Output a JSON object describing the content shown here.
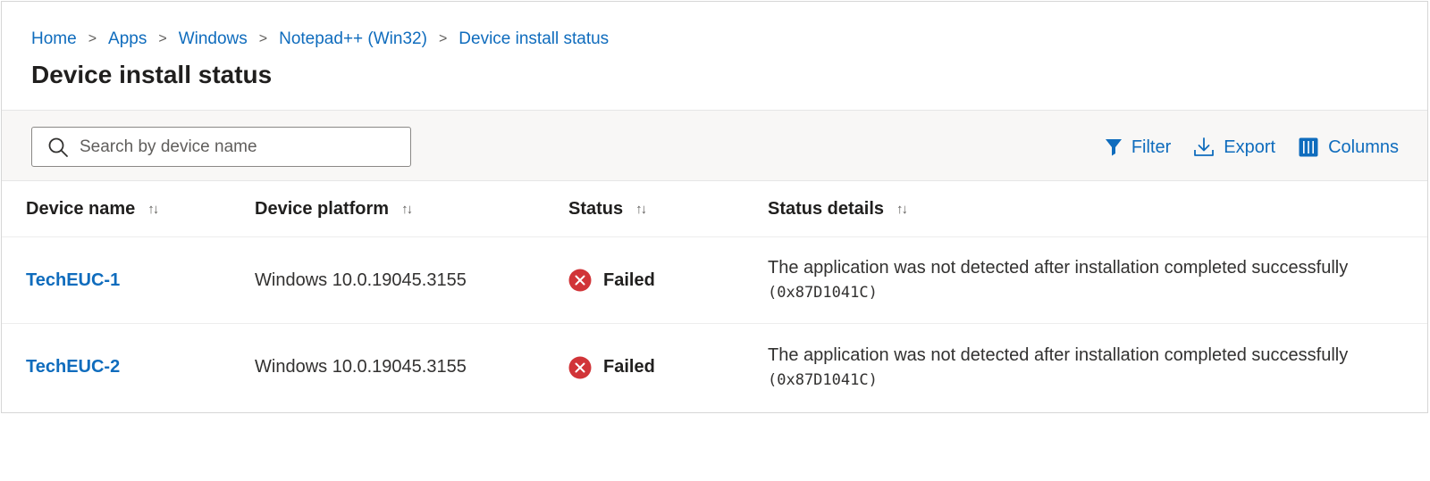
{
  "breadcrumb": {
    "items": [
      "Home",
      "Apps",
      "Windows",
      "Notepad++ (Win32)",
      "Device install status"
    ],
    "separator": ">"
  },
  "page": {
    "title": "Device install status"
  },
  "search": {
    "placeholder": "Search by device name",
    "value": ""
  },
  "toolbar": {
    "filter_label": "Filter",
    "export_label": "Export",
    "columns_label": "Columns"
  },
  "table": {
    "sort_glyph": "↑↓",
    "columns": [
      "Device name",
      "Device platform",
      "Status",
      "Status details"
    ],
    "rows": [
      {
        "device": "TechEUC-1",
        "platform": "Windows 10.0.19045.3155",
        "status": "Failed",
        "details": "The application was not detected after installation completed successfully",
        "code": "(0x87D1041C)"
      },
      {
        "device": "TechEUC-2",
        "platform": "Windows 10.0.19045.3155",
        "status": "Failed",
        "details": "The application was not detected after installation completed successfully",
        "code": "(0x87D1041C)"
      }
    ]
  },
  "colors": {
    "link": "#0f6cbd",
    "error": "#d13438",
    "toolbar_bg": "#f8f7f6",
    "text": "#201f1e"
  },
  "icons": {
    "search": "search-icon",
    "filter": "filter-icon",
    "export": "export-icon",
    "columns": "columns-icon",
    "status_failed": "error-circle-icon"
  }
}
